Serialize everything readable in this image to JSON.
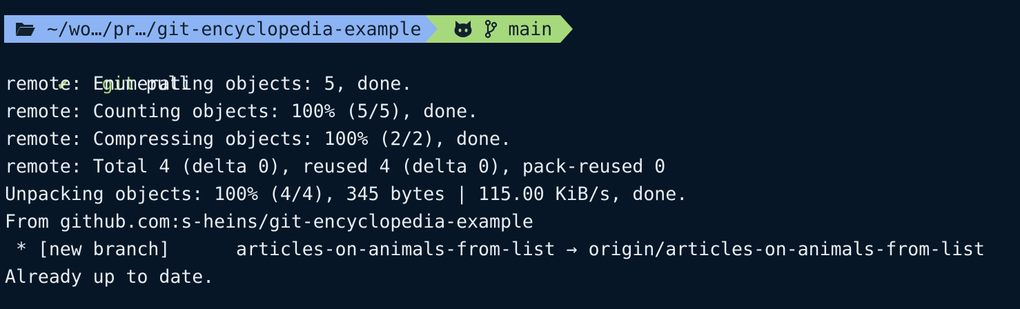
{
  "prompt": {
    "path": "~/wo…/pr…/git-encyclopedia-example",
    "branch": "main",
    "folder_icon": "folder-open-icon",
    "github_icon": "github-icon",
    "branch_icon": "git-branch-icon",
    "colors": {
      "dir_bg": "#8cb4f4",
      "git_bg": "#a6d97c",
      "terminal_bg": "#061626"
    }
  },
  "command": {
    "status_glyph": "✔",
    "text": "git",
    "args": " pull"
  },
  "output": [
    "remote: Enumerating objects: 5, done.",
    "remote: Counting objects: 100% (5/5), done.",
    "remote: Compressing objects: 100% (2/2), done.",
    "remote: Total 4 (delta 0), reused 4 (delta 0), pack-reused 0",
    "Unpacking objects: 100% (4/4), 345 bytes | 115.00 KiB/s, done.",
    "From github.com:s-heins/git-encyclopedia-example",
    " * [new branch]      articles-on-animals-from-list → origin/articles-on-animals-from-list",
    "Already up to date."
  ]
}
